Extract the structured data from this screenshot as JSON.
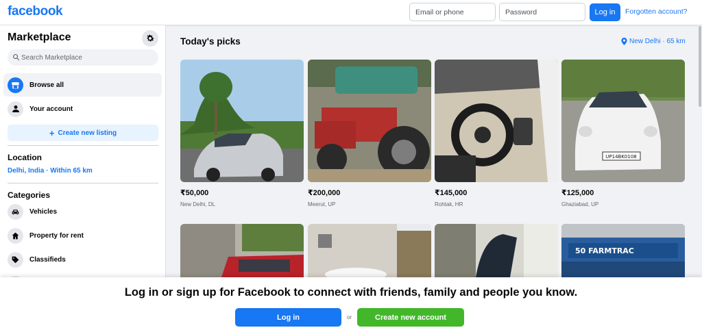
{
  "header": {
    "logo": "facebook",
    "email_placeholder": "Email or phone",
    "password_placeholder": "Password",
    "login_label": "Log in",
    "forgot_label": "Forgotten account?"
  },
  "sidebar": {
    "title": "Marketplace",
    "search_placeholder": "Search Marketplace",
    "items": [
      {
        "label": "Browse all",
        "icon": "storefront-icon"
      },
      {
        "label": "Your account",
        "icon": "person-icon"
      }
    ],
    "create_label": "Create new listing",
    "location_title": "Location",
    "location_value": "Delhi, India · Within 65 km",
    "categories_title": "Categories",
    "categories": [
      {
        "label": "Vehicles",
        "icon": "car-icon"
      },
      {
        "label": "Property for rent",
        "icon": "house-icon"
      },
      {
        "label": "Classifieds",
        "icon": "tag-icon"
      }
    ]
  },
  "main": {
    "title": "Today's picks",
    "location_tag": "New Delhi · 65 km",
    "listings": [
      {
        "price": "₹50,000",
        "city": "New Delhi, DL"
      },
      {
        "price": "₹200,000",
        "city": "Meerut, UP"
      },
      {
        "price": "₹145,000",
        "city": "Rohtak, HR"
      },
      {
        "price": "₹125,000",
        "city": "Ghaziabad, UP"
      }
    ]
  },
  "banner": {
    "text": "Log in or sign up for Facebook to connect with friends, family and people you know.",
    "login_label": "Log in",
    "or_label": "or",
    "create_label": "Create new account"
  },
  "colors": {
    "brand": "#1877f2",
    "success": "#42b72a",
    "background": "#f0f2f5"
  }
}
